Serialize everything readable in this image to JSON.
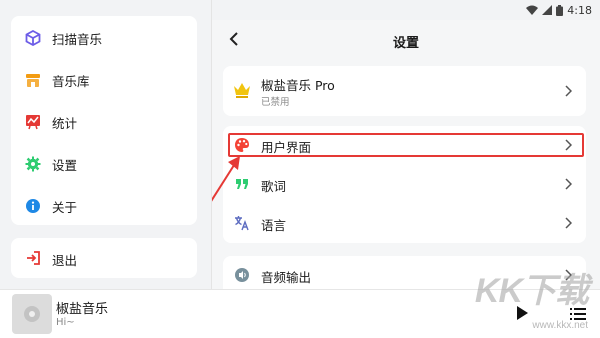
{
  "status_bar": {
    "time": "4:18"
  },
  "sidebar": {
    "items": [
      {
        "label": "扫描音乐",
        "icon": "cube-scan-icon",
        "color": "#6c5ce7"
      },
      {
        "label": "音乐库",
        "icon": "store-icon",
        "color": "#f39c12"
      },
      {
        "label": "统计",
        "icon": "chart-board-icon",
        "color": "#e53935"
      },
      {
        "label": "设置",
        "icon": "gear-icon",
        "color": "#2ecc71"
      },
      {
        "label": "关于",
        "icon": "info-icon",
        "color": "#1e88e5"
      }
    ],
    "logout": {
      "label": "退出",
      "icon": "exit-icon",
      "color": "#e53935"
    }
  },
  "player": {
    "title": "椒盐音乐",
    "subtitle": "Hi~"
  },
  "settings": {
    "title": "设置",
    "pro": {
      "title": "椒盐音乐 Pro",
      "status": "已禁用",
      "icon": "crown-icon",
      "color": "#f1c40f"
    },
    "items": [
      {
        "label": "用户界面",
        "icon": "palette-icon",
        "color": "#f44336",
        "highlighted": true
      },
      {
        "label": "歌词",
        "icon": "quote-icon",
        "color": "#2ecc71"
      },
      {
        "label": "语言",
        "icon": "translate-icon",
        "color": "#5c6bc0"
      }
    ],
    "audio": {
      "label": "音频输出",
      "icon": "speaker-icon",
      "color": "#78909c"
    }
  },
  "watermark": {
    "big": "KK下载",
    "small": "www.kkx.net"
  },
  "colors": {
    "accent_red": "#e53935",
    "background": "#f2f3f5"
  }
}
